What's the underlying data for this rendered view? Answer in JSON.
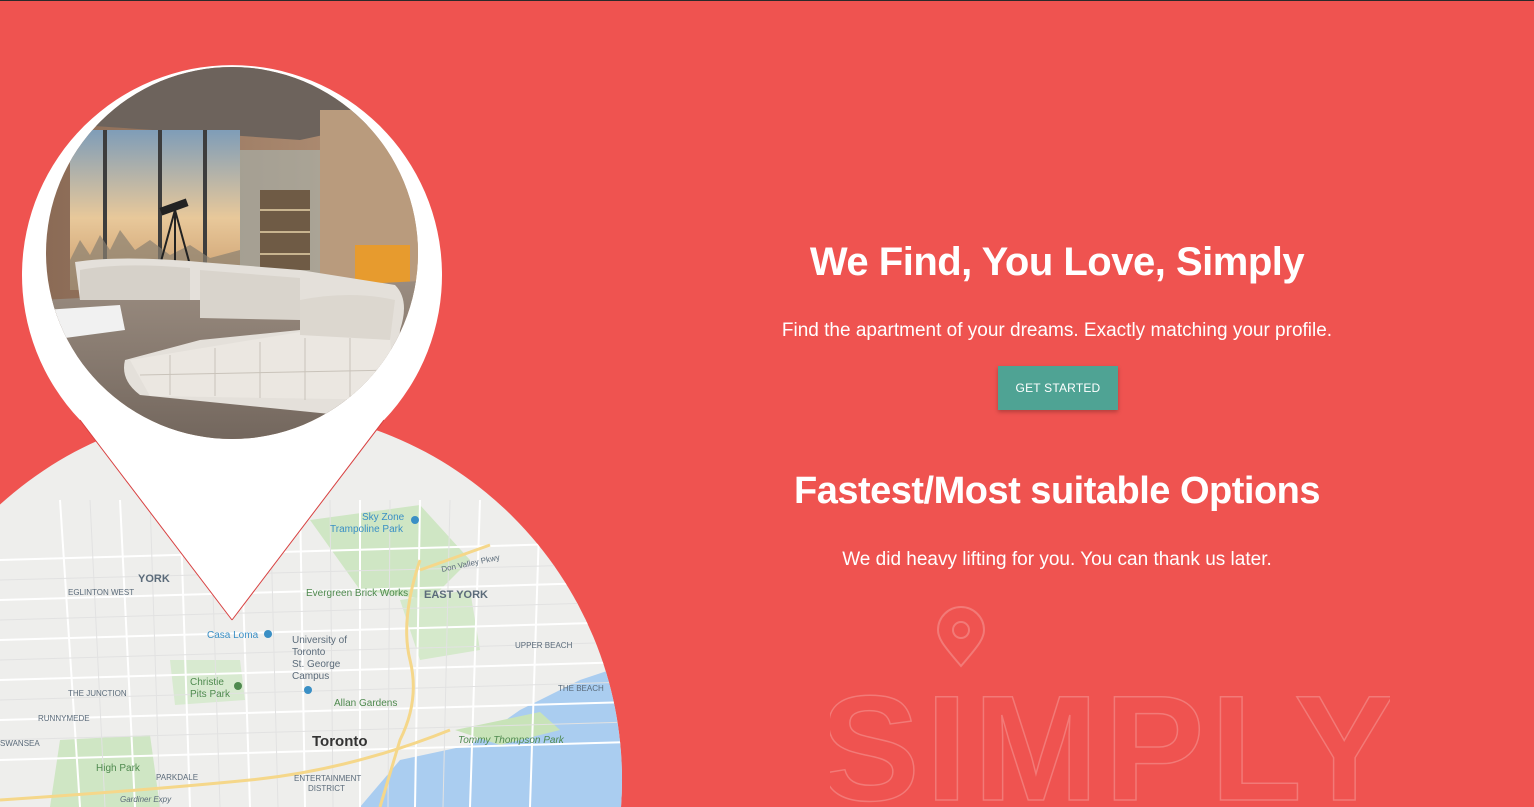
{
  "hero": {
    "headline": "We Find, You Love, Simply",
    "subtitle": "Find the apartment of your dreams. Exactly matching your profile.",
    "cta_label": "GET STARTED"
  },
  "features": {
    "headline": "Fastest/Most suitable Options",
    "subtitle": "We did heavy lifting for you. You can thank us later."
  },
  "watermark": {
    "text": "SIMPLY"
  },
  "map": {
    "labels": {
      "sky_zone": "Sky Zone",
      "trampoline_park": "Trampoline Park",
      "york": "YORK",
      "eglinton_west": "EGLINTON WEST",
      "evergreen": "Evergreen Brick Works",
      "east_york": "EAST YORK",
      "don_valley": "Don Valley Pkwy",
      "casa_loma": "Casa Loma",
      "uoft_1": "University of",
      "uoft_2": "Toronto",
      "uoft_3": "St. George",
      "uoft_4": "Campus",
      "upper_beach": "UPPER BEACH",
      "christie_1": "Christie",
      "christie_2": "Pits Park",
      "the_junction": "THE JUNCTION",
      "allan_gardens": "Allan Gardens",
      "the_beach": "THE BEACH",
      "runnymede": "RUNNYMEDE",
      "toronto": "Toronto",
      "tommy_thompson": "Tommy Thompson Park",
      "high_park": "High Park",
      "parkdale": "PARKDALE",
      "entertainment_1": "ENTERTAINMENT",
      "entertainment_2": "DISTRICT",
      "gardiner": "Gardiner Expy",
      "swansea": "SWANSEA"
    }
  },
  "colors": {
    "background": "#ef5350",
    "cta": "#4fa394",
    "text": "#ffffff"
  }
}
